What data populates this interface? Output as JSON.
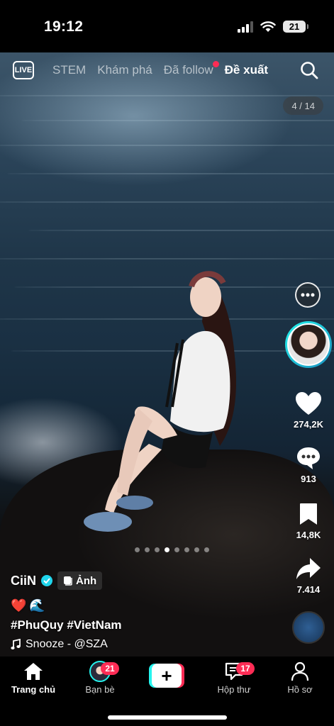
{
  "status_bar": {
    "time": "19:12",
    "battery": "21"
  },
  "top_nav": {
    "live_label": "LIVE",
    "tabs": [
      {
        "label": "STEM",
        "active": false
      },
      {
        "label": "Khám phá",
        "active": false
      },
      {
        "label": "Đã follow",
        "active": false,
        "has_dot": true
      },
      {
        "label": "Đề xuất",
        "active": true
      }
    ]
  },
  "page_counter": "4 / 14",
  "rail": {
    "likes": "274,2K",
    "comments": "913",
    "saves": "14,8K",
    "shares": "7.414"
  },
  "pager": {
    "total": 8,
    "active_index": 3
  },
  "caption": {
    "author": "CiiN",
    "photo_badge": "Ảnh",
    "emojis": [
      "❤️",
      "🌊"
    ],
    "hashtags": "#PhuQuy #VietNam",
    "music": "Snooze - @SZA"
  },
  "tab_bar": {
    "home": "Trang chủ",
    "friends": "Bạn bè",
    "friends_badge": "21",
    "inbox": "Hộp thư",
    "inbox_badge": "17",
    "profile": "Hồ sơ",
    "create_symbol": "+"
  },
  "colors": {
    "accent_red": "#fe2c55",
    "accent_cyan": "#25f4ee",
    "verified": "#20d5ec"
  }
}
